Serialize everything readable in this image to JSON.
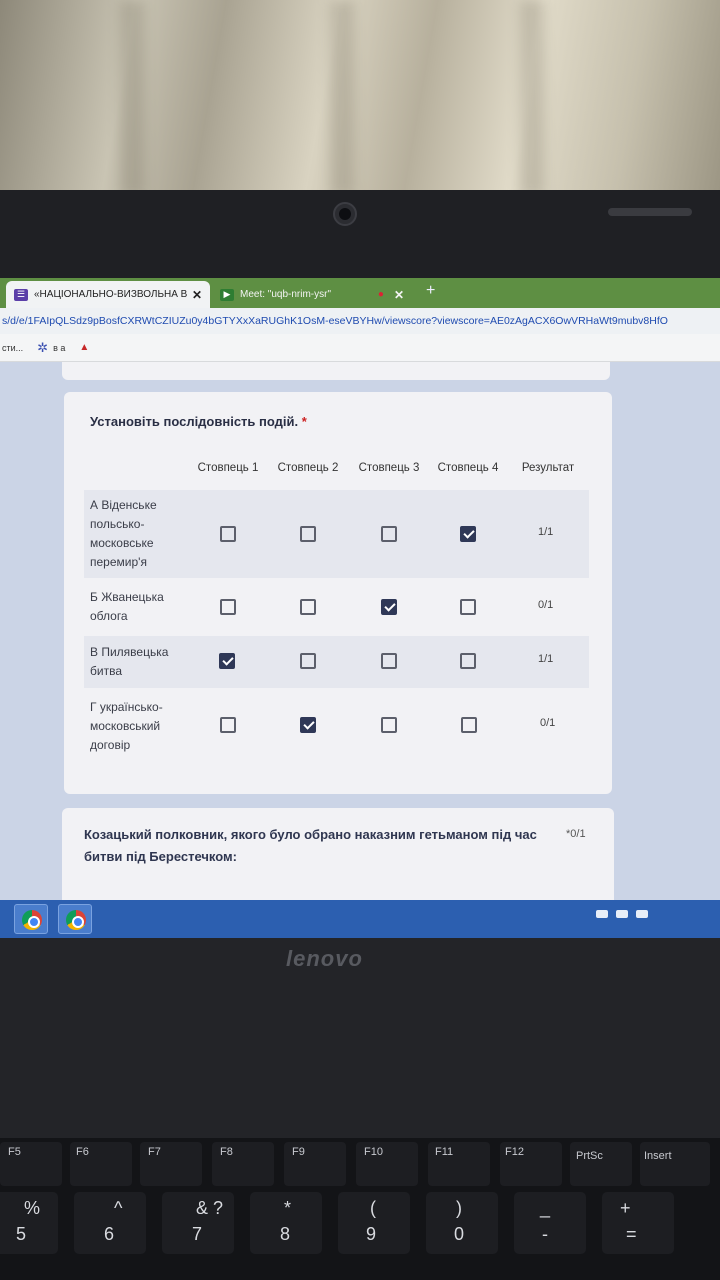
{
  "browser": {
    "tabs": [
      {
        "title": "«НАЦІОНАЛЬНО-ВИЗВОЛЬНА В",
        "active": true
      },
      {
        "title": "Meet: \"uqb-nrim-ysr\"",
        "active": false
      }
    ],
    "url": "s/d/e/1FAIpQLSdz9pBosfCXRWtCZIUZu0y4bGTYXxXaRUGhK1OsM-eseVBYHw/viewscore?viewscore=AE0zAgACX6OwVRHaWt9mubv8HfO",
    "bookmarks": [
      "сти...",
      "в а"
    ]
  },
  "question1": {
    "title": "Установіть послідовність подій.",
    "required_mark": "*",
    "columns": [
      "Стовпець 1",
      "Стовпець 2",
      "Стовпець 3",
      "Стовпець 4"
    ],
    "result_header": "Результат",
    "rows": [
      {
        "label": "А Віденське польсько-московське перемир'я",
        "checked": [
          false,
          false,
          false,
          true
        ],
        "score": "1/1"
      },
      {
        "label": "Б Жванецька облога",
        "checked": [
          false,
          false,
          true,
          false
        ],
        "score": "0/1"
      },
      {
        "label": "В Пилявецька битва",
        "checked": [
          true,
          false,
          false,
          false
        ],
        "score": "1/1"
      },
      {
        "label": "Г українсько-московський договір",
        "checked": [
          false,
          true,
          false,
          false
        ],
        "score": "0/1"
      }
    ]
  },
  "question2": {
    "title": "Козацький полковник, якого було обрано наказним гетьманом під час битви під Берестечком:",
    "score": "*0/1"
  },
  "laptop": {
    "brand": "lenovo",
    "fkeys": [
      "F5",
      "F6",
      "F7",
      "F8",
      "F9",
      "F10",
      "F11",
      "F12",
      "PrtSc",
      "Insert"
    ],
    "numkeys": [
      {
        "top": "%",
        "bottom": "5"
      },
      {
        "top": "^",
        "bottom": "6"
      },
      {
        "top": "& ?",
        "bottom": "7"
      },
      {
        "top": "*",
        "bottom": "8"
      },
      {
        "top": "(",
        "bottom": "9"
      },
      {
        "top": ")",
        "bottom": "0"
      },
      {
        "top": "_",
        "bottom": "-"
      },
      {
        "top": "+",
        "bottom": "="
      }
    ]
  }
}
